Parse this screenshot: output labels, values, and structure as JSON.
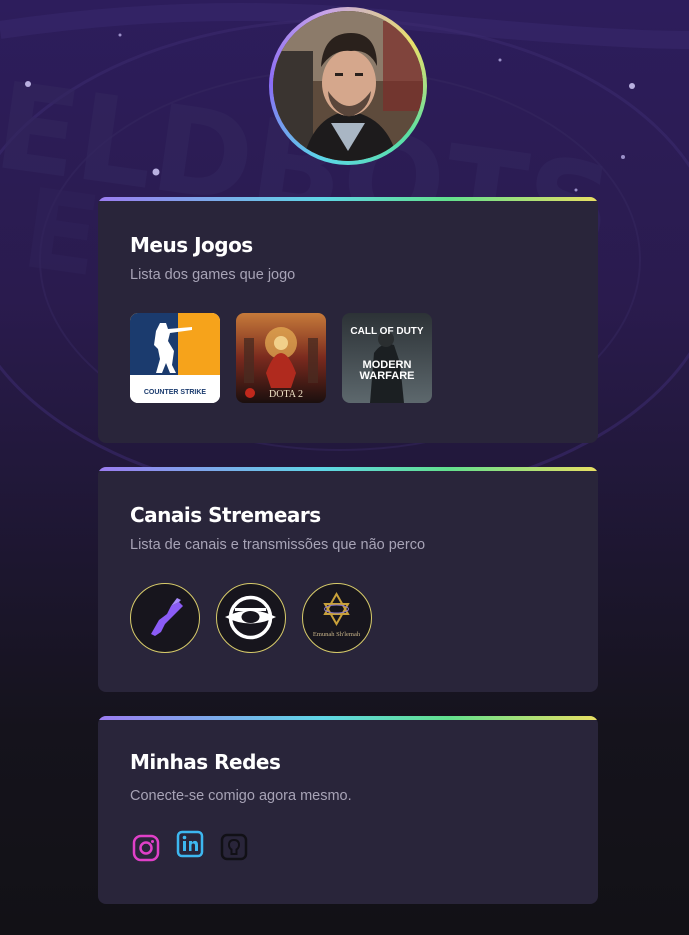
{
  "profile": {
    "avatar_alt": "profile-photo"
  },
  "games_card": {
    "title": "Meus Jogos",
    "subtitle": "Lista dos games que jogo",
    "games": [
      {
        "name": "Counter-Strike",
        "logo_text": "COUNTER STRIKE"
      },
      {
        "name": "Dota 2",
        "logo_text": "DOTA 2"
      },
      {
        "name": "Call of Duty Modern Warfare",
        "logo_text_top": "CALL OF DUTY",
        "logo_text_mid": "MODERN",
        "logo_text_bot": "WARFARE"
      }
    ]
  },
  "channels_card": {
    "title": "Canais Stremears",
    "subtitle": "Lista de canais e transmissões que não perco",
    "channels": [
      {
        "icon": "purple-gun-icon"
      },
      {
        "icon": "eye-emblem-icon"
      },
      {
        "icon": "star-of-david-icon",
        "label": "Emunah Sh'lemah"
      }
    ]
  },
  "social_card": {
    "title": "Minhas Redes",
    "subtitle": "Conecte-se comigo agora mesmo.",
    "links": [
      {
        "icon": "instagram-icon",
        "color": "#e040c8"
      },
      {
        "icon": "linkedin-icon",
        "color": "#3db7f0"
      },
      {
        "icon": "github-icon",
        "color": "#111016"
      }
    ]
  },
  "colors": {
    "card_bg": "#29253a",
    "accent_gradient": [
      "#9b7cf0",
      "#5fd6e6",
      "#62e08e",
      "#e9df63"
    ],
    "subtitle": "#a7a3b6"
  }
}
